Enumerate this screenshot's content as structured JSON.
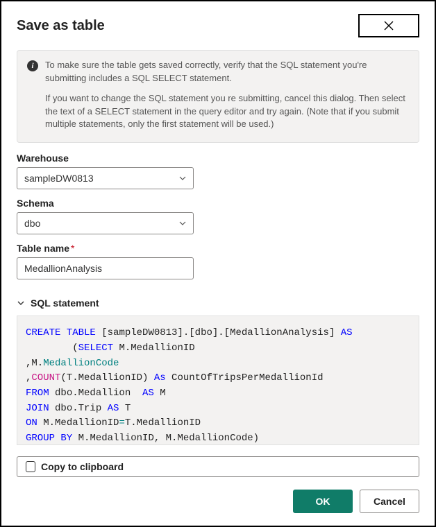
{
  "dialog": {
    "title": "Save as table"
  },
  "info": {
    "p1": "To make sure the table gets saved correctly, verify that the SQL statement you're submitting includes a SQL SELECT statement.",
    "p2": "If you want to change the SQL statement you re submitting, cancel this dialog. Then select the text of a SELECT statement in the query editor and try again. (Note that if you submit multiple statements, only the first statement will be used.)"
  },
  "fields": {
    "warehouse": {
      "label": "Warehouse",
      "value": "sampleDW0813"
    },
    "schema": {
      "label": "Schema",
      "value": "dbo"
    },
    "tableName": {
      "label": "Table name",
      "value": "MedallionAnalysis"
    }
  },
  "sqlSection": {
    "label": "SQL statement"
  },
  "sql": {
    "tokens": [
      {
        "t": "CREATE",
        "c": "kw-blue"
      },
      {
        "t": " "
      },
      {
        "t": "TABLE",
        "c": "kw-blue"
      },
      {
        "t": " [sampleDW0813].[dbo].[MedallionAnalysis] "
      },
      {
        "t": "AS",
        "c": "kw-blue"
      },
      {
        "t": "\n        ("
      },
      {
        "t": "SELECT",
        "c": "kw-blue"
      },
      {
        "t": " M.MedallionID\n,M."
      },
      {
        "t": "MedallionCode",
        "c": "kw-teal"
      },
      {
        "t": "\n,"
      },
      {
        "t": "COUNT",
        "c": "kw-magenta"
      },
      {
        "t": "(T.MedallionID) "
      },
      {
        "t": "As",
        "c": "kw-blue"
      },
      {
        "t": " CountOfTripsPerMedallionId\n"
      },
      {
        "t": "FROM",
        "c": "kw-blue"
      },
      {
        "t": " dbo.Medallion  "
      },
      {
        "t": "AS",
        "c": "kw-blue"
      },
      {
        "t": " M\n"
      },
      {
        "t": "JOIN",
        "c": "kw-blue"
      },
      {
        "t": " dbo.Trip "
      },
      {
        "t": "AS",
        "c": "kw-blue"
      },
      {
        "t": " T\n"
      },
      {
        "t": "ON",
        "c": "kw-blue"
      },
      {
        "t": " M.MedallionID"
      },
      {
        "t": "=",
        "c": "kw-teal"
      },
      {
        "t": "T.MedallionID\n"
      },
      {
        "t": "GROUP",
        "c": "kw-blue"
      },
      {
        "t": " "
      },
      {
        "t": "BY",
        "c": "kw-blue"
      },
      {
        "t": " M.MedallionID, M.MedallionCode)"
      }
    ]
  },
  "buttons": {
    "copy": "Copy to clipboard",
    "ok": "OK",
    "cancel": "Cancel"
  }
}
